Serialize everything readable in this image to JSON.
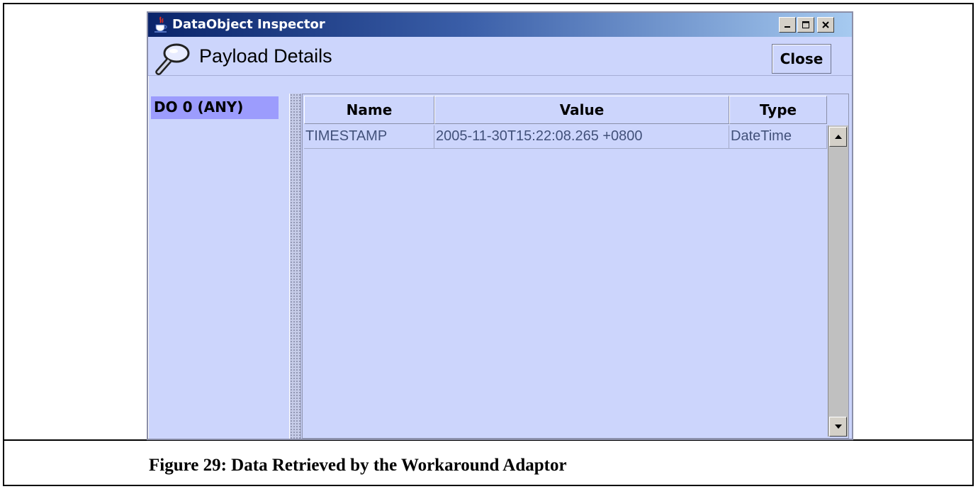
{
  "window": {
    "title": "DataObject Inspector",
    "buttons": [
      "minimize",
      "maximize",
      "close"
    ]
  },
  "header": {
    "title": "Payload Details",
    "close_label": "Close"
  },
  "tree": {
    "items": [
      {
        "label": "DO 0 (ANY)",
        "selected": true
      }
    ]
  },
  "table": {
    "columns": [
      "Name",
      "Value",
      "Type"
    ],
    "rows": [
      [
        "TIMESTAMP",
        "2005-11-30T15:22:08.265 +0800",
        "DateTime"
      ]
    ]
  },
  "caption": "Figure 29: Data Retrieved by the Workaround Adaptor",
  "colors": {
    "titlebar_start": "#0a246a",
    "titlebar_end": "#a6caf0",
    "panel_bg": "#ccd5fc",
    "selection_bg": "#9c9cfd",
    "cell_text": "#42517a"
  },
  "icons": {
    "app": "java-cup-icon",
    "header": "magnifier-icon"
  }
}
